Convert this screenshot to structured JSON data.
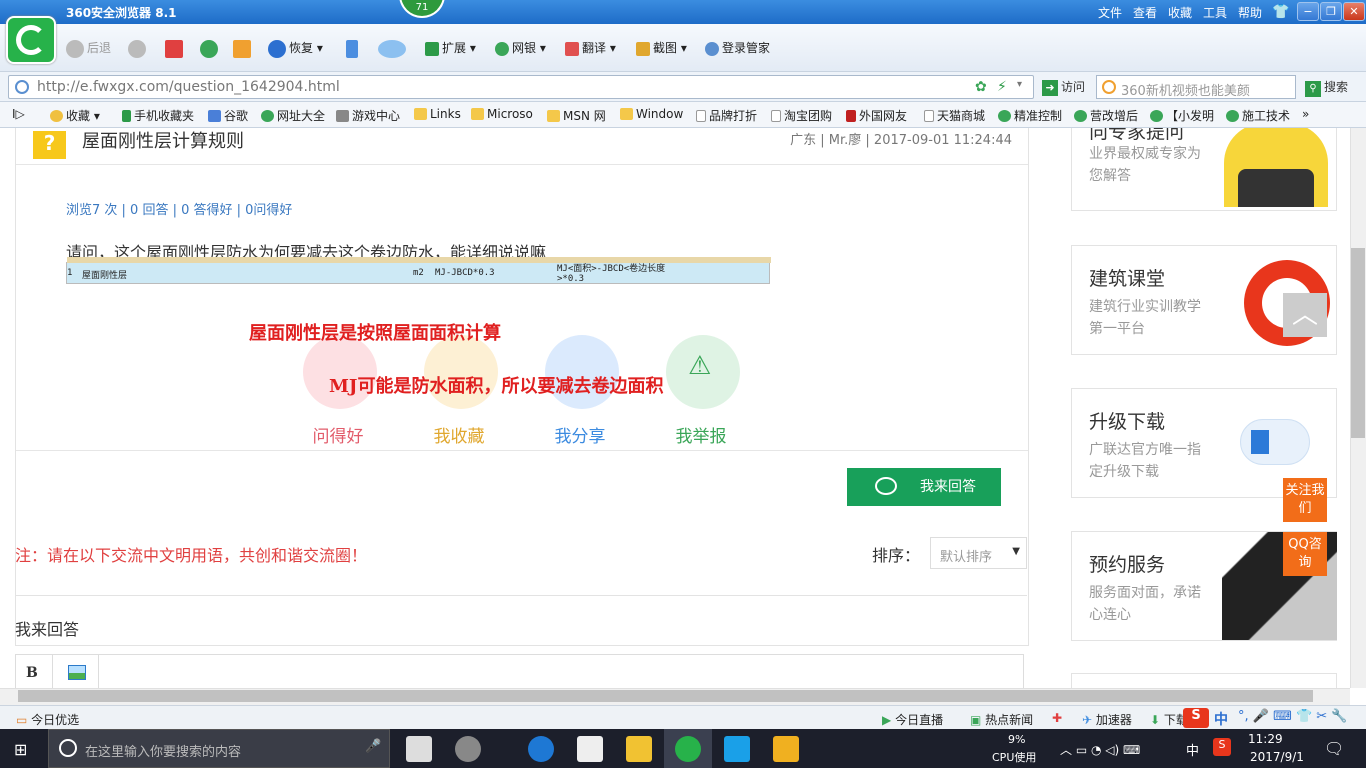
{
  "browser": {
    "title": "360安全浏览器 8.1",
    "badge": "71",
    "menu": [
      "文件",
      "查看",
      "收藏",
      "工具",
      "帮助"
    ],
    "toolbar": {
      "back": "后退",
      "restore": "恢复",
      "extend": "扩展",
      "bank": "网银",
      "translate": "翻译",
      "screenshot": "截图",
      "login": "登录管家"
    },
    "url": "http://e.fwxgx.com/question_1642904.html",
    "visit": "访问",
    "search_placeholder": "360新机视频也能美颜",
    "search_btn": "搜索",
    "bookmarks": [
      "收藏",
      "手机收藏夹",
      "谷歌",
      "网址大全",
      "游戏中心",
      "Links",
      "Microso",
      "MSN 网",
      "Window",
      "品牌打折",
      "淘宝团购",
      "外国网友",
      "天猫商城",
      "精准控制",
      "营改增后",
      "【小发明",
      "施工技术"
    ]
  },
  "question": {
    "icon": "?",
    "title": "屋面刚性层计算规则",
    "meta": "广东 | Mr.廖 | 2017-09-01 11:24:44",
    "stats": "浏览7 次 | 0 回答 | 0 答得好 | 0问得好",
    "body": "请问，这个屋面刚性层防水为何要减去这个卷边防水，能详细说说嘛",
    "table": {
      "row_no": "1",
      "name": "屋面刚性层",
      "unit": "m2",
      "formula": "MJ-JBCD*0.3",
      "desc": "MJ<面积>-JBCD<卷边长度>*0.3"
    },
    "annotation1": "屋面刚性层是按照屋面面积计算",
    "annotation2": "MJ可能是防水面积，所以要减去卷边面积",
    "actions": [
      {
        "label": "问得好",
        "color": "#e25c6b"
      },
      {
        "label": "我收藏",
        "color": "#e0a72e"
      },
      {
        "label": "我分享",
        "color": "#3c8be0"
      },
      {
        "label": "我举报",
        "color": "#3aa658"
      }
    ],
    "answer_btn": "我来回答"
  },
  "comments": {
    "note": "注：请在以下交流中文明用语，共创和谐交流圈！",
    "sort_label": "排序：",
    "sort_value": "默认排序",
    "my_answer": "我来回答",
    "editor_bold": "B"
  },
  "sidebar": {
    "cards": [
      {
        "title": "向专家提问",
        "sub": "业界最权威专家为您解答"
      },
      {
        "title": "建筑课堂",
        "sub": "建筑行业实训教学第一平台"
      },
      {
        "title": "升级下载",
        "sub": "广联达官方唯一指定升级下载"
      },
      {
        "title": "预约服务",
        "sub": "服务面对面，承诺心连心"
      }
    ],
    "follow": "关注我们",
    "qq": "QQ咨询"
  },
  "statusbar": {
    "left": "今日优选",
    "live": "今日直播",
    "news": "热点新闻",
    "accel": "加速器",
    "download": "下载",
    "ime": "中"
  },
  "taskbar": {
    "search": "在这里输入你要搜索的内容",
    "cpu_pct": "9%",
    "cpu_label": "CPU使用",
    "ime": "中",
    "time": "11:29",
    "date": "2017/9/1"
  }
}
